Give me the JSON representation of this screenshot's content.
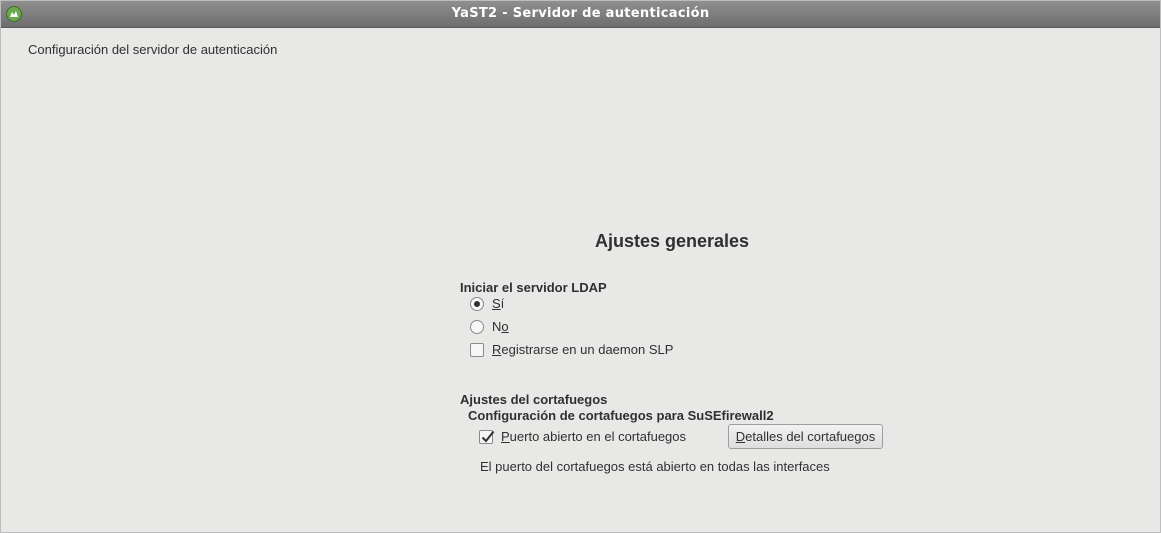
{
  "window": {
    "title": "YaST2 - Servidor de autenticación",
    "icon": "yast-app-icon"
  },
  "header": {
    "label": "Configuración del servidor de autenticación"
  },
  "main": {
    "section_title": "Ajustes generales",
    "ldap": {
      "group_label": "Iniciar el servidor LDAP",
      "options": [
        {
          "mnemonic": "S",
          "rest": "í",
          "selected": true
        },
        {
          "prefix": "N",
          "mnemonic": "o",
          "selected": false
        }
      ],
      "slp": {
        "mnemonic": "R",
        "rest": "egistrarse en un daemon SLP",
        "checked": false
      }
    },
    "firewall": {
      "group_label": "Ajustes del cortafuegos",
      "subgroup_label": "Configuración de cortafuegos para SuSEfirewall2",
      "open_port": {
        "mnemonic": "P",
        "rest": "uerto abierto en el cortafuegos",
        "checked": true
      },
      "details_button": {
        "mnemonic": "D",
        "rest": "etalles del cortafuegos"
      },
      "status_text": "El puerto del cortafuegos está abierto en todas las interfaces"
    }
  }
}
